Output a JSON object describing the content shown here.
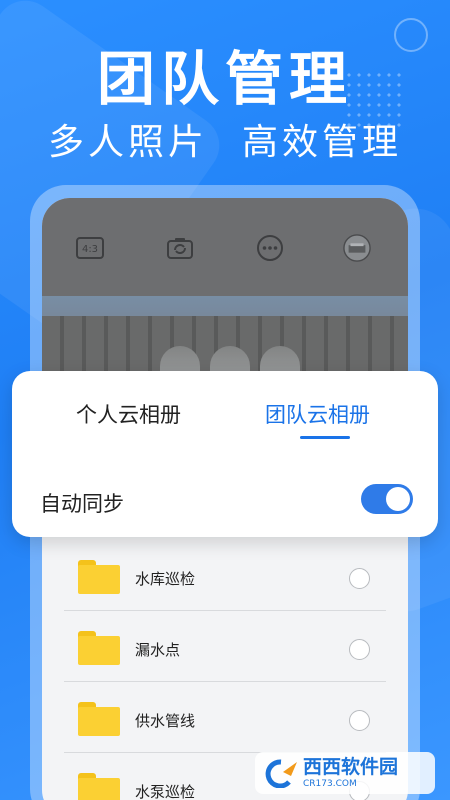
{
  "headline": "团队管理",
  "subline": {
    "left": "多人照片",
    "right": "高效管理"
  },
  "camera_bar": {
    "ratio_label": "4:3"
  },
  "sync_card": {
    "tab_personal": "个人云相册",
    "tab_team": "团队云相册",
    "auto_sync_label": "自动同步",
    "auto_sync_on": true,
    "accent_color": "#1a73e8"
  },
  "folders": [
    {
      "name": "水库巡检"
    },
    {
      "name": "漏水点"
    },
    {
      "name": "供水管线"
    },
    {
      "name": "水泵巡检"
    }
  ],
  "watermark": {
    "brand": "西西软件园",
    "domain": "CR173.COM"
  },
  "colors": {
    "background": "#1f7ff5",
    "folder": "#fbd033",
    "toggle": "#2f7be8"
  }
}
